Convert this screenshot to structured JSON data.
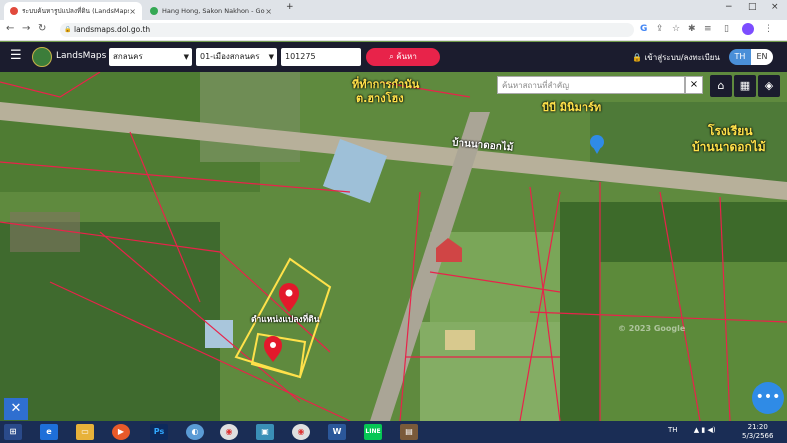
{
  "tabs": [
    {
      "title": "ระบบค้นหารูปแปลงที่ดิน (LandsMaps)",
      "close": "×",
      "active": true
    },
    {
      "title": "Hang Hong, Sakon Nakhon - Go",
      "close": "×",
      "active": false
    }
  ],
  "new_tab": "+",
  "window_controls": {
    "minimize": "−",
    "maximize": "□",
    "close": "×"
  },
  "address_bar": {
    "url": "landsmaps.dol.go.th"
  },
  "app": {
    "brand": "LandsMaps",
    "province": "สกลนคร",
    "district": "01-เมืองสกลนคร",
    "parcel_number": "101275",
    "search_label": "ค้นหา",
    "login_label": "เข้าสู่ระบบ/ลงทะเบียน",
    "lang_th": "TH",
    "lang_en": "EN"
  },
  "map": {
    "search_placeholder": "ค้นหาสถานที่สำคัญ",
    "search_clear": "×",
    "labels": {
      "office": "ที่ทำการกำนัน",
      "office2": "ต.ฮางโฮง",
      "shop": "บีบี มินิมาร์ท",
      "road": "บ้านนาดอกไม้",
      "school": "โรงเรียน",
      "school2": "บ้านนาดอกไม้",
      "parcel": "ตำแหน่งแปลงที่ดิน",
      "watermark": "© 2023 Google"
    },
    "fab_label": "•••",
    "close_label": "✕"
  },
  "taskbar": {
    "lang": "TH",
    "time": "21:20",
    "date": "5/3/2566"
  },
  "colors": {
    "brand_bar": "#1b1c2e",
    "search_button": "#e8234a",
    "lang_active": "#4a8fd8",
    "parcel_outline": "#ffe14a",
    "boundary": "#e8234a"
  }
}
